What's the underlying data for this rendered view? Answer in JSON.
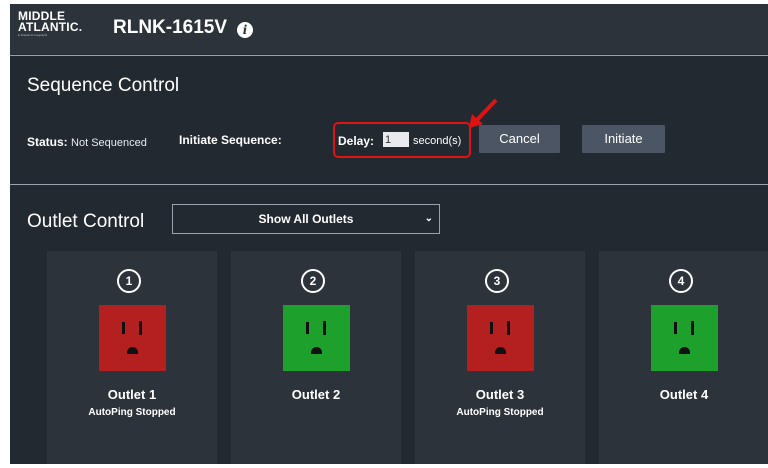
{
  "header": {
    "brand_line1": "MIDDLE",
    "brand_line2": "ATLANTIC.",
    "brand_tagline": "a brand of Legrand",
    "model": "RLNK-1615V",
    "info_icon": "info-icon"
  },
  "sequence": {
    "title": "Sequence Control",
    "status_label": "Status:",
    "status_value": "Not Sequenced",
    "initiate_label": "Initiate Sequence:",
    "delay_label": "Delay:",
    "delay_value": "1",
    "delay_unit": "second(s)",
    "cancel_label": "Cancel",
    "initiate_button": "Initiate",
    "highlight_color": "#e01313"
  },
  "outlet_control": {
    "title": "Outlet Control",
    "filter_selected": "Show All Outlets",
    "outlets": [
      {
        "number": "1",
        "name": "Outlet 1",
        "status": "AutoPing Stopped",
        "state": "off",
        "color": "#b3201f"
      },
      {
        "number": "2",
        "name": "Outlet 2",
        "status": "",
        "state": "on",
        "color": "#1ea02d"
      },
      {
        "number": "3",
        "name": "Outlet 3",
        "status": "AutoPing Stopped",
        "state": "off",
        "color": "#b3201f"
      },
      {
        "number": "4",
        "name": "Outlet 4",
        "status": "",
        "state": "on",
        "color": "#1ea02d"
      }
    ]
  }
}
